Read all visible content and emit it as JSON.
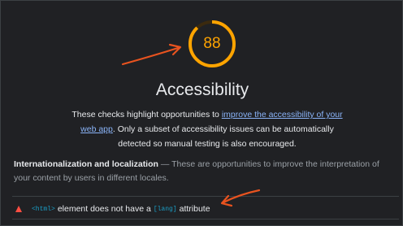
{
  "category": {
    "score": "88",
    "title": "Accessibility",
    "description_pre": "These checks highlight opportunities to ",
    "description_link": "improve the accessibility of your web app",
    "description_post": ". Only a subset of accessibility issues can be automatically detected so manual testing is also encouraged.",
    "gauge_color": "#ffa400"
  },
  "group": {
    "title": "Internationalization and localization",
    "separator": " — ",
    "description": "These are opportunities to improve the interpretation of your content by users in different locales."
  },
  "audit": {
    "code_element": "<html>",
    "text_middle": "element does not have a",
    "code_attribute": "[lang]",
    "text_end": "attribute",
    "status": "fail",
    "status_color": "#ff4e42"
  },
  "annotation": {
    "arrow_color": "#e8531f"
  }
}
